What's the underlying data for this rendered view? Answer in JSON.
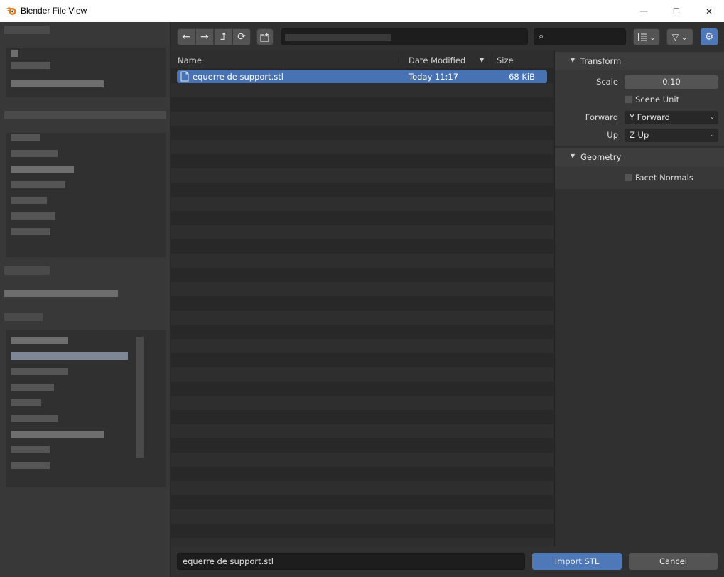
{
  "window": {
    "title": "Blender File View",
    "controls": {
      "minimize": "—",
      "maximize": "☐",
      "close": "✕"
    }
  },
  "toolbar": {
    "back_icon": "←",
    "forward_icon": "→",
    "parent_icon": "⮥",
    "refresh_icon": "⟳",
    "new_folder_icon": "new-folder-icon",
    "search_placeholder": "",
    "view_mode_icon": "display-mode-icon",
    "filter_icon": "▽",
    "chevron": "⌄",
    "settings_icon": "⚙"
  },
  "file_list": {
    "columns": {
      "name": "Name",
      "date": "Date Modified",
      "size": "Size",
      "sort_indicator": "▼"
    },
    "files": [
      {
        "name": "equerre de support.stl",
        "date": "Today 11:17",
        "size": "68 KiB",
        "selected": true
      }
    ]
  },
  "properties": {
    "transform": {
      "header": "Transform",
      "scale_label": "Scale",
      "scale_value": "0.10",
      "scene_unit_label": "Scene Unit",
      "scene_unit_checked": false,
      "forward_label": "Forward",
      "forward_value": "Y Forward",
      "up_label": "Up",
      "up_value": "Z Up"
    },
    "geometry": {
      "header": "Geometry",
      "facet_normals_label": "Facet Normals",
      "facet_normals_checked": false
    },
    "triangle": "▼",
    "chevron": "⌄"
  },
  "bottom": {
    "filename": "equerre de support.stl",
    "import_label": "Import STL",
    "cancel_label": "Cancel"
  },
  "colors": {
    "accent": "#4f78b8",
    "selection": "#4772b3",
    "background": "#2b2b2b"
  }
}
